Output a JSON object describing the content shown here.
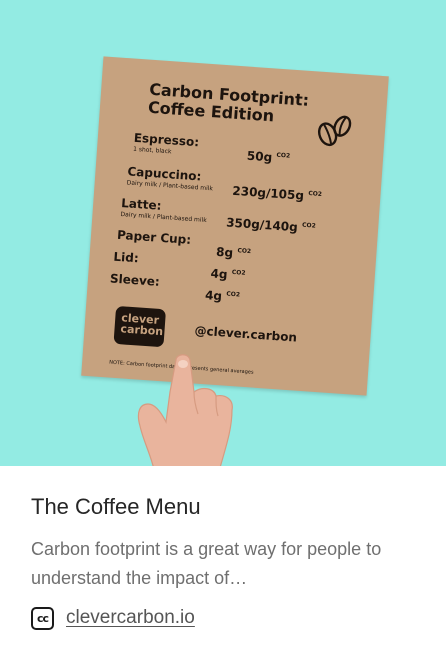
{
  "image": {
    "background_color": "#93ebe3",
    "board": {
      "title_line1": "Carbon Footprint:",
      "title_line2": "Coffee Edition",
      "icon": "coffee-beans-icon",
      "rows": [
        {
          "name": "Espresso:",
          "sub": "1 shot, black",
          "value": "50g",
          "unit": "CO2"
        },
        {
          "name": "Capuccino:",
          "sub": "Dairy milk / Plant-based milk",
          "value": "230g/105g",
          "unit": "CO2"
        },
        {
          "name": "Latte:",
          "sub": "Dairy milk / Plant-based milk",
          "value": "350g/140g",
          "unit": "CO2"
        },
        {
          "name": "Paper Cup:",
          "sub": "",
          "value": "8g",
          "unit": "CO2"
        },
        {
          "name": "Lid:",
          "sub": "",
          "value": "4g",
          "unit": "CO2"
        },
        {
          "name": "Sleeve:",
          "sub": "",
          "value": "4g",
          "unit": "CO2"
        }
      ],
      "badge_line1": "clever",
      "badge_line2": "carbon",
      "handle": "@clever.carbon",
      "note": "NOTE: Carbon footprint data represents general averages"
    }
  },
  "card": {
    "title": "The Coffee Menu",
    "description": "Carbon footprint is a great way for people to understand the impact of…",
    "source_icon": "cc-logo-icon",
    "source_text": "clevercarbon.io"
  }
}
